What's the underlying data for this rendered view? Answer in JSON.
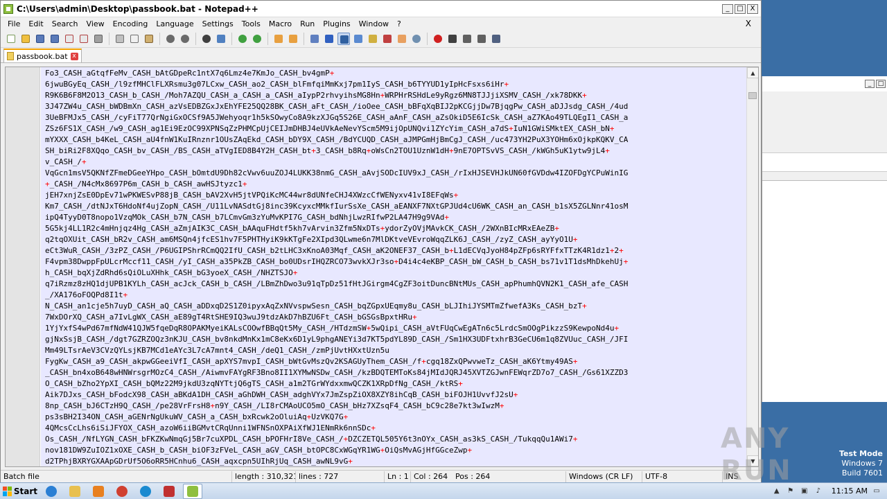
{
  "window": {
    "title": "C:\\Users\\admin\\Desktop\\passbook.bat - Notepad++",
    "minimize": "_",
    "maximize": "□",
    "close": "X"
  },
  "menubar": {
    "items": [
      "File",
      "Edit",
      "Search",
      "View",
      "Encoding",
      "Language",
      "Settings",
      "Tools",
      "Macro",
      "Run",
      "Plugins",
      "Window",
      "?"
    ],
    "close": "X"
  },
  "tab": {
    "label": "passbook.bat",
    "close": "x"
  },
  "editor": {
    "lines": [
      "Fo3_CASH_aGtqfFeMv_CASH_bAtGDpeRc1ntX7q6Lmz4e7KmJo_CASH_bv4gmP+",
      "6jwuBGyEq_CASH_/l9zfMHClFLXRsmu3g07LCxw_CASH_ao2_CASH_blFmfqiMmKxj7pm1IyS_CASH_b6TYYUD1yIpHcFsxs6iHr+",
      "R9K6B6F8M2O13_CASH_b_CASH_/Moh7AZQU_CASH_a_CASH_a_CASH_aIypP2rhvyihsMG8Hn+WRPHrRSHdLe9yRgz6MN8TJJjiXSMV_CASH_/xk78DKK+",
      "3J47ZW4u_CASH_bWDBmXn_CASH_azVsEDBZGxJxEhYFE25QQ28BK_CASH_aFt_CASH_/ioOee_CASH_bBFqXqBIJ2pKCGjjDw7BjqgPw_CASH_aDJJsdg_CASH_/4ud",
      "3UeBFMJx5_CASH_/cyFiT77QrNgiGxOCSf9A5JWehyoqr1h5kSOwyCo8A9kzXJGq5S26E_CASH_aAnF_CASH_aZsOkiD5E6IcSk_CASH_aZ7KAo49TLQEgI1_CASH_a",
      "ZSz6FS1X_CASH_/w9_CASH_ag1Ei9EzOC99XPNSqZzPHMCpUjCEIJmDHBJ4eUVkAeNevYScm5M9ijOpUNQvi1ZYcYim_CASH_a7dS+IuN1GWiSMktEX_CASH_bN+",
      "mYXXX_CASH_b4KeL_CASH_aU4fnW1KuIRnznr1OUsZAqEkd_CASH_bDY9X_CASH_/BdYCUQD_CASH_aJMPGmHjBmCgJ_CASH_/uc473YH2PuX3YOHm6xOjkpKQKV_CA",
      "SH_biRi2F8XQqo_CASH_bv_CASH_/BS_CASH_aTVgIED8B4Y2H_CASH_bt+3_CASH_b8Rq+oWsCn2TOU1UznW1dH+9nE7OPTSvVS_CASH_/kWGh5uK1ytw9jL4+",
      "v_CASH_/+",
      "VqGcn1msV5QKNfZFmeDGeeYHpo_CASH_bOmtdU9Dh82cVwv6uuZOJ4LUKK38nmG_CASH_aAvjSODcIUV9xJ_CASH_/rIxHJSEVHJkUN60fGVDdw4IZOFDgYCPuWinIG",
      "+_CASH_/N4cMx8697P6m_CASH_b_CASH_awHSJtyzc1+",
      "jEH7xnjZsE0DpEv71wPKWESvP88jB_CASH_bAV2XvH5jtVPQiKcMC44wr8dUNfeCHJ4XWzcCfWENyxv41vI8EFqWs+",
      "Km7_CASH_/dtNJxT6HdoNf4ujZopN_CASH_/U11LvNASdtGj8inc39KcyxcMMkfIurSsXe_CASH_aEANXF7NXtGPJUd4cU6WK_CASH_an_CASH_b1sX5ZGLNnr41osM",
      "ipQ4TyyD0T8nopo1VzqMOk_CASH_b7N_CASH_b7LCmvGm3zYuMvKPI7G_CASH_bdNhjLwzRIfwP2LA47H9g9VAd+",
      "5G5kj4LL1R2c4mHnjqz4Hg_CASH_aZmjAIK3C_CASH_bAAquFHdtf5kh7vArvin3Zfm5NxDTs+ydorZyOVjMAvkCK_CASH_/2WXnBIcMRxEAeZB+",
      "q2tqOXUit_CASH_bR2v_CASH_am6MSQn4jfcES1hv7F5PHTHyiK9kKTgFe2XIpd3QLwme6n7MlDKtveVEvroWqqZLK6J_CASH_/zyZ_CASH_ayYyO1U+",
      "eCt3WuR_CASH_/3zPZ_CASH_/P6UGIPShrRCmQQ2IfU_CASH_b2tLHC3xKnoA03Mqf_CASH_aK2ONEF37_CASH_b+L1dECVqJyoH84pZFp6sRYFfxTTzK4R1dz1+2+",
      "F4vpm38DwppFpULcrMccf11_CASH_/yI_CASH_a35PkZB_CASH_bo0UDsrIHQZRCO73wvkXJr3so+D4i4c4eKBP_CASH_bW_CASH_b_CASH_bs71v1T1dsMhDkehUj+",
      "h_CASH_bqXjZdRhd6sQiOLuXHhk_CASH_bG3yoeX_CASH_/NHZTSJO+",
      "q7iRzmz8zHQ1djUPB1KYLh_CASH_acJck_CASH_b_CASH_/LBmZhDwo3u91qTpDz51fHtJGirgm4CgZF3oitDuncBNtMUs_CASH_apPhumhQVN2K1_CASH_afe_CASH",
      "_/XA176oFOQPd8I1t+",
      "N_CASH_an1cje5h7uyD_CASH_aQ_CASH_aDDxqD2S1Z0ipyxAqZxNVvspwSesn_CASH_bqZGpxUEqmy8u_CASH_bLJIhiJYSMTmZfwefA3Ks_CASH_bzT+",
      "7WxDOrXQ_CASH_a7IvLgWX_CASH_aE89gT4RtSHE9IQ3wuJ9tdzAkD7hBZU6Ft_CASH_bGSGsBpxtHRu+",
      "1YjYxfS4wPd67mfNdW41QJW5fqeDqR8OPAKMyeiKALsCOOwfBBqQt5My_CASH_/HTdzmSW+5wQipi_CASH_aVtFUqCwEgATn6c5LrdcSmOOgPikzzS9KewpoNd4u+",
      "gjNxSsjB_CASH_/dgt7GZRZOQz3nKJU_CASH_bv8nkdMnKx1mC8eKx6D1yL9phgANEYi3d7KT5pdYL89D_CASH_/Sm1HX3UDFtxhrB3GeCU6m1q8ZVUuc_CASH_/JFI",
      "Mm49LTsrAeV3CVzQYLsjKB7MCd1eAYc3L7cA7mnt4_CASH_/deQ1_CASH_/zmPjUvtHXxtUzn5u",
      "FygKw_CASH_a9_CASH_akpwGGeeiVfI_CASH_apXYS7mvpI_CASH_bWtGvMszQv2KSAGUyThem_CASH_/f+cgq18ZxQPwvweTz_CASH_aK6Ytmy49AS+",
      "_CASH_bn4xoB648wHNWrsgrMOzC4_CASH_/AiwmvFAYgRF3Bno8II1XYMwNSDw_CASH_/kzBDQTEMToKs84jMIdJQRJ45XVTZGJwnFEWqrZD7o7_CASH_/Gs61XZZD3",
      "O_CASH_bZho2YpXI_CASH_bQMz22M9jkdU3zqNYTtjQ6gTS_CASH_a1m2TGrWYdxxmwQCZK1XRpDfNg_CASH_/ktRS+",
      "Aik7DJxs_CASH_bFodcX98_CASH_aBKdA1DH_CASH_aGhDWH_CASH_adghVYx7JmZspZiOX8XZY8ihCqB_CASH_biFOJH1UvvfJ2sU+",
      "8np_CASH_bJ6CTzH9Q_CASH_/pe28VrFrsH8+n9Y_CASH_/LI8rCMAoUCO5mO_CASH_bHz7XZsqF4_CASH_bC9c28e7kt3wIwzM+",
      "ps3sBH2I34ON_CASH_aGENrNgUkuWV_CASH_a_CASH_bxRcwk2oOluiAq+UzVKQ7G+",
      "4QMcsCcLhs6iSiJFYOX_CASH_azoW6iiBGMvtCRqUnni1WFNSnOXPAiXfWJ1ENmRk6nnSDc+",
      "Os_CASH_/NfLYGN_CASH_bFKZKwNmqGj5Br7cuXPDL_CASH_bPOFHrI8Ve_CASH_/+DZCZETQL505Y6t3nOYx_CASH_as3kS_CASH_/TukqqQu1AWi7+",
      "nov181DW9ZuIOZ1xOXE_CASH_b_CASH_biOF3zFVeL_CASH_aGV_CASH_btOPC8CxWGqYR1WG+OiQsMvAGjHfGGceZwp+",
      "d2TPhjBXRYGXAApGDrUf5O6oRR5HCnhu6_CASH_aqxcpn5UIhRjUq_CASH_awNL9vG+"
    ]
  },
  "statusbar": {
    "filetype": "Batch file",
    "length": "length : 310,321",
    "lines": "lines : 727",
    "ln": "Ln : 1",
    "col": "Col : 264",
    "pos": "Pos : 264",
    "eol": "Windows (CR LF)",
    "encoding": "UTF-8",
    "mode": "INS"
  },
  "watermark": "ANY RUN",
  "testmode": {
    "line1": "Test Mode",
    "line2": "Windows 7",
    "line3": "Build 7601"
  },
  "taskbar": {
    "start_label": "Start",
    "clock": "11:15 AM"
  },
  "colors": {
    "code_bg": "#e8e8ff",
    "operator": "#ff0000",
    "highlight": "#3399dd",
    "tab_accent": "#f5a300"
  }
}
